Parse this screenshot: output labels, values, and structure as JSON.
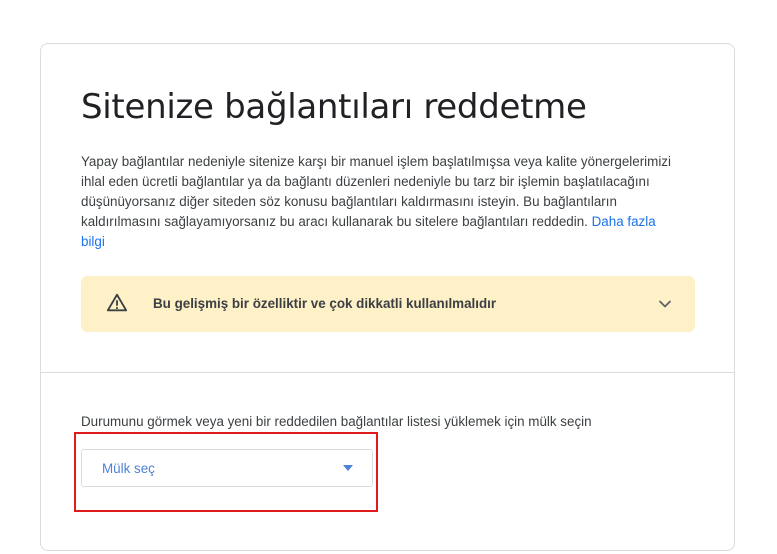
{
  "page": {
    "title": "Sitenize bağlantıları reddetme",
    "description": "Yapay bağlantılar nedeniyle sitenize karşı bir manuel işlem başlatılmışsa veya kalite yönergelerimizi ihlal eden ücretli bağlantılar ya da bağlantı düzenleri nedeniyle bu tarz bir işlemin başlatılacağını düşünüyorsanız diğer siteden söz konusu bağlantıları kaldırmasını isteyin. Bu bağlantıların kaldırılmasını sağlayamıyorsanız bu aracı kullanarak bu sitelere bağlantıları reddedin.",
    "learn_more_link": "Daha fazla bilgi"
  },
  "warning": {
    "icon": "warning-triangle-icon",
    "text": "Bu gelişmiş bir özelliktir ve çok dikkatli kullanılmalıdır",
    "expand_icon": "chevron-down-icon"
  },
  "property_select": {
    "label": "Durumunu görmek veya yeni bir reddedilen bağlantılar listesi yüklemek için mülk seçin",
    "placeholder": "Mülk seç",
    "arrow_icon": "dropdown-arrow-icon"
  },
  "colors": {
    "link": "#1a73e8",
    "warning_bg": "#fef0c7",
    "highlight_border": "#e01b1b",
    "select_text": "#4c82d8"
  }
}
